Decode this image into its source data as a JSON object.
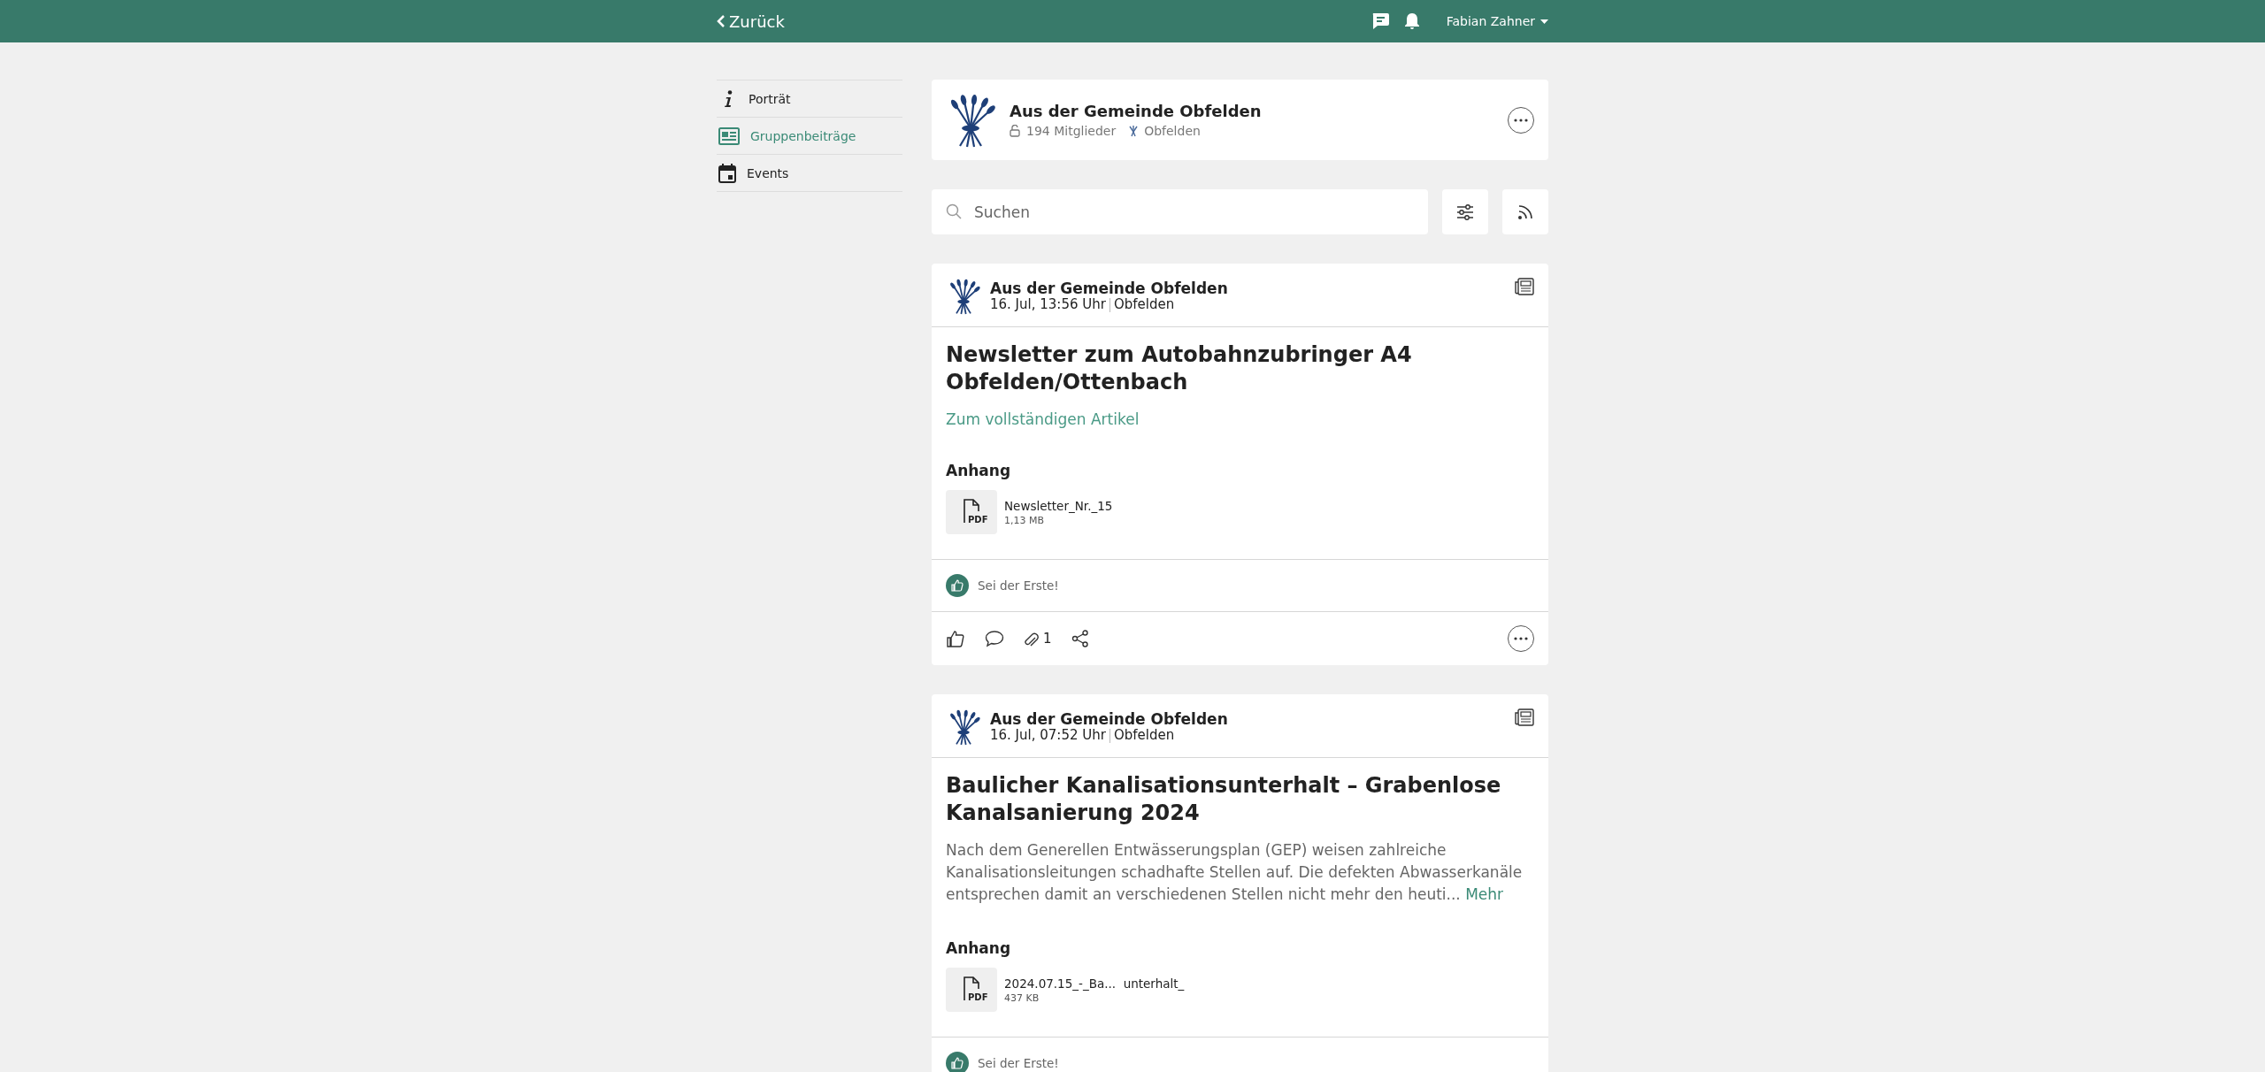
{
  "top_bar": {
    "back": "Zurück",
    "user": "Fabian Zahner"
  },
  "sidebar": {
    "items": [
      {
        "label": "Porträt",
        "kind": "info",
        "selected": false
      },
      {
        "label": "Gruppenbeiträge",
        "kind": "posts",
        "selected": true
      },
      {
        "label": "Events",
        "kind": "events",
        "selected": false
      }
    ]
  },
  "group": {
    "name": "Aus der Gemeinde Obfelden",
    "members": "194 Mitglieder",
    "location": "Obfelden"
  },
  "search": {
    "placeholder": "Suchen"
  },
  "posts": [
    {
      "author": "Aus der Gemeinde Obfelden",
      "date": "16. Jul, 13:56 Uhr",
      "location": "Obfelden",
      "title": "Newsletter zum Autobahnzubringer A4 Obfelden/Ottenbach",
      "link": "Zum vollständigen Artikel",
      "attachments_heading": "Anhang",
      "attachment": {
        "name": "Newsletter_Nr._15",
        "size": "1,13 MB",
        "file_type": "PDF"
      },
      "reactions": "Sei der Erste!",
      "attachment_count": "1"
    },
    {
      "author": "Aus der Gemeinde Obfelden",
      "date": "16. Jul, 07:52 Uhr",
      "location": "Obfelden",
      "title": "Baulicher Kanalisationsunterhalt – Grabenlose Kanalsanierung 2024",
      "excerpt": "Nach dem Generellen Entwässerungsplan (GEP) weisen zahlreiche Kanalisationsleitungen schadhafte Stellen auf. Die defekten Abwasserkanäle entsprechen damit an verschiedenen Stellen nicht mehr den heuti...",
      "more": "Mehr",
      "attachments_heading": "Anhang",
      "attachment": {
        "name": "2024.07.15_-_Ba...  unterhalt_",
        "size": "437 KB",
        "file_type": "PDF"
      },
      "reactions": "Sei der Erste!"
    }
  ]
}
